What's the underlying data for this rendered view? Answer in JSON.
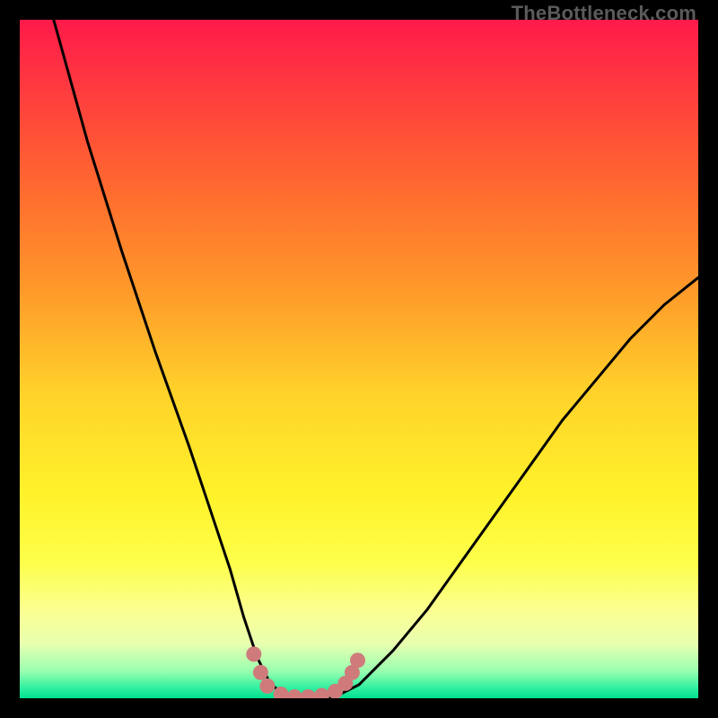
{
  "watermark": {
    "text": "TheBottleneck.com"
  },
  "colors": {
    "black": "#000000",
    "curve_stroke": "#000000",
    "marker_fill": "#cf7b7b",
    "gradient_stops": [
      {
        "offset": 0.0,
        "color": "#ff1a4a"
      },
      {
        "offset": 0.1,
        "color": "#ff3a3f"
      },
      {
        "offset": 0.25,
        "color": "#ff6a2f"
      },
      {
        "offset": 0.4,
        "color": "#ff9a2a"
      },
      {
        "offset": 0.55,
        "color": "#ffd22a"
      },
      {
        "offset": 0.7,
        "color": "#fff22a"
      },
      {
        "offset": 0.8,
        "color": "#fdff4a"
      },
      {
        "offset": 0.87,
        "color": "#fbff90"
      },
      {
        "offset": 0.92,
        "color": "#e8ffb0"
      },
      {
        "offset": 0.96,
        "color": "#9affb0"
      },
      {
        "offset": 0.985,
        "color": "#30f0a0"
      },
      {
        "offset": 1.0,
        "color": "#00e090"
      }
    ]
  },
  "chart_data": {
    "type": "line",
    "title": "",
    "xlabel": "",
    "ylabel": "",
    "xlim": [
      0,
      100
    ],
    "ylim": [
      0,
      100
    ],
    "series": [
      {
        "name": "bottleneck-curve",
        "x": [
          5,
          10,
          15,
          20,
          25,
          28,
          31,
          33,
          35,
          37,
          40,
          43,
          46,
          50,
          55,
          60,
          65,
          70,
          75,
          80,
          85,
          90,
          95,
          100
        ],
        "y": [
          100,
          82,
          66,
          51,
          37,
          28,
          19,
          12,
          6,
          2,
          0,
          0,
          0,
          2,
          7,
          13,
          20,
          27,
          34,
          41,
          47,
          53,
          58,
          62
        ]
      }
    ],
    "markers": {
      "name": "bottom-cluster",
      "points": [
        {
          "x": 34.5,
          "y": 6.5
        },
        {
          "x": 35.5,
          "y": 3.8
        },
        {
          "x": 36.5,
          "y": 1.8
        },
        {
          "x": 38.5,
          "y": 0.6
        },
        {
          "x": 40.5,
          "y": 0.2
        },
        {
          "x": 42.5,
          "y": 0.2
        },
        {
          "x": 44.5,
          "y": 0.4
        },
        {
          "x": 46.5,
          "y": 1.0
        },
        {
          "x": 48.0,
          "y": 2.2
        },
        {
          "x": 49.0,
          "y": 3.8
        },
        {
          "x": 49.8,
          "y": 5.6
        }
      ]
    }
  }
}
